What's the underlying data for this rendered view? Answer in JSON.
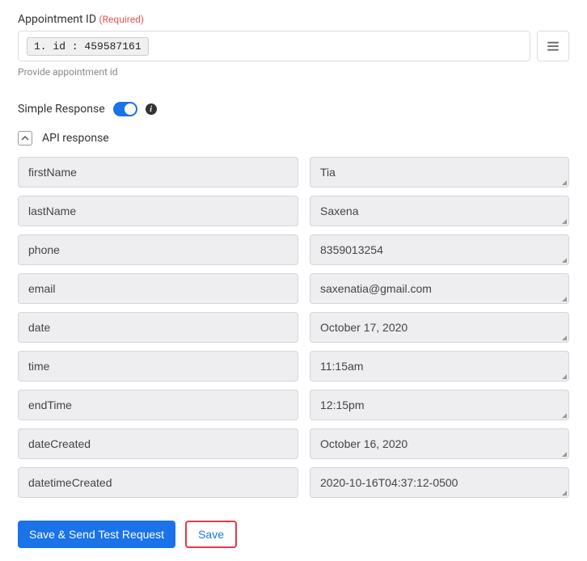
{
  "appointment": {
    "label": "Appointment ID",
    "required_tag": "(Required)",
    "token": "1. id : 459587161",
    "help_text": "Provide appointment id"
  },
  "simpleResponse": {
    "label": "Simple Response"
  },
  "apiResponse": {
    "title": "API response",
    "rows": [
      {
        "key": "firstName",
        "value": "Tia"
      },
      {
        "key": "lastName",
        "value": "Saxena"
      },
      {
        "key": "phone",
        "value": "8359013254"
      },
      {
        "key": "email",
        "value": "saxenatia@gmail.com"
      },
      {
        "key": "date",
        "value": "October 17, 2020"
      },
      {
        "key": "time",
        "value": "11:15am"
      },
      {
        "key": "endTime",
        "value": "12:15pm"
      },
      {
        "key": "dateCreated",
        "value": "October 16, 2020"
      },
      {
        "key": "datetimeCreated",
        "value": "2020-10-16T04:37:12-0500"
      }
    ]
  },
  "buttons": {
    "save_send": "Save & Send Test Request",
    "save": "Save"
  }
}
